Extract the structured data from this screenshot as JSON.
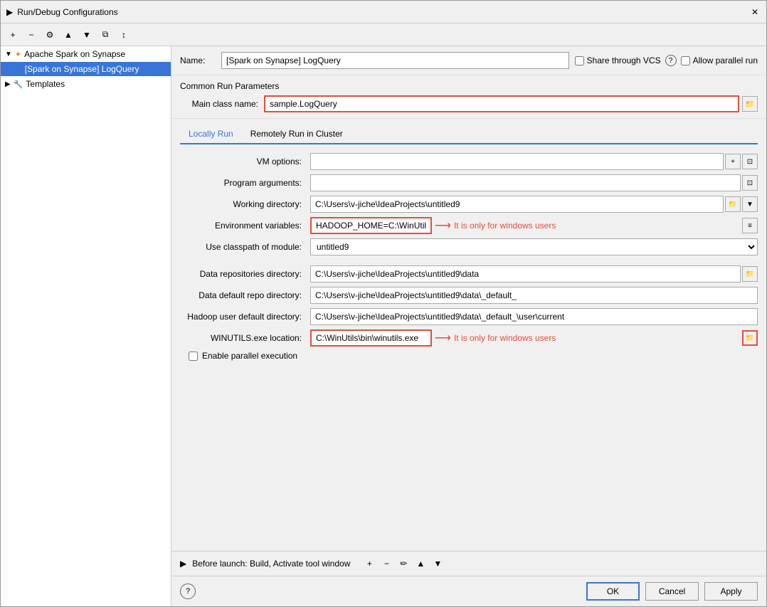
{
  "window": {
    "title": "Run/Debug Configurations",
    "icon": "▶"
  },
  "toolbar": {
    "add": "+",
    "remove": "−",
    "settings": "⚙",
    "up_arrow": "▲",
    "down_arrow": "▼",
    "copy": "⧉",
    "sort": "↕"
  },
  "sidebar": {
    "group_label": "Apache Spark on Synapse",
    "item_label": "[Spark on Synapse] LogQuery",
    "templates_label": "Templates"
  },
  "header": {
    "name_label": "Name:",
    "name_value": "[Spark on Synapse] LogQuery",
    "share_vcs_label": "Share through VCS",
    "parallel_run_label": "Allow parallel run",
    "help_text": "?"
  },
  "common_params": {
    "title": "Common Run Parameters",
    "main_class_label": "Main class name:",
    "main_class_value": "sample.LogQuery"
  },
  "tabs": {
    "locally_run": "Locally Run",
    "remotely_run": "Remotely Run in Cluster"
  },
  "locally_run": {
    "vm_options_label": "VM options:",
    "vm_options_value": "",
    "program_args_label": "Program arguments:",
    "program_args_value": "",
    "working_dir_label": "Working directory:",
    "working_dir_value": "C:\\Users\\v-jiche\\IdeaProjects\\untitled9",
    "env_vars_label": "Environment variables:",
    "env_vars_value": "HADOOP_HOME=C:\\WinUtils",
    "env_vars_note": "It is only for windows users",
    "classpath_label": "Use classpath of module:",
    "classpath_value": "untitled9",
    "data_repos_label": "Data repositories directory:",
    "data_repos_value": "C:\\Users\\v-jiche\\IdeaProjects\\untitled9\\data",
    "data_default_label": "Data default repo directory:",
    "data_default_value": "C:\\Users\\v-jiche\\IdeaProjects\\untitled9\\data\\_default_",
    "hadoop_user_label": "Hadoop user default directory:",
    "hadoop_user_value": "C:\\Users\\v-jiche\\IdeaProjects\\untitled9\\data\\_default_\\user\\current",
    "winutils_label": "WINUTILS.exe location:",
    "winutils_value": "C:\\WinUtils\\bin\\winutils.exe",
    "winutils_note": "It is only for windows users",
    "parallel_exec_label": "Enable parallel execution",
    "arrow": "→"
  },
  "before_launch": {
    "label": "Before launch: Build, Activate tool window",
    "expand_icon": "▶"
  },
  "bottom_buttons": {
    "ok": "OK",
    "cancel": "Cancel",
    "apply": "Apply"
  }
}
